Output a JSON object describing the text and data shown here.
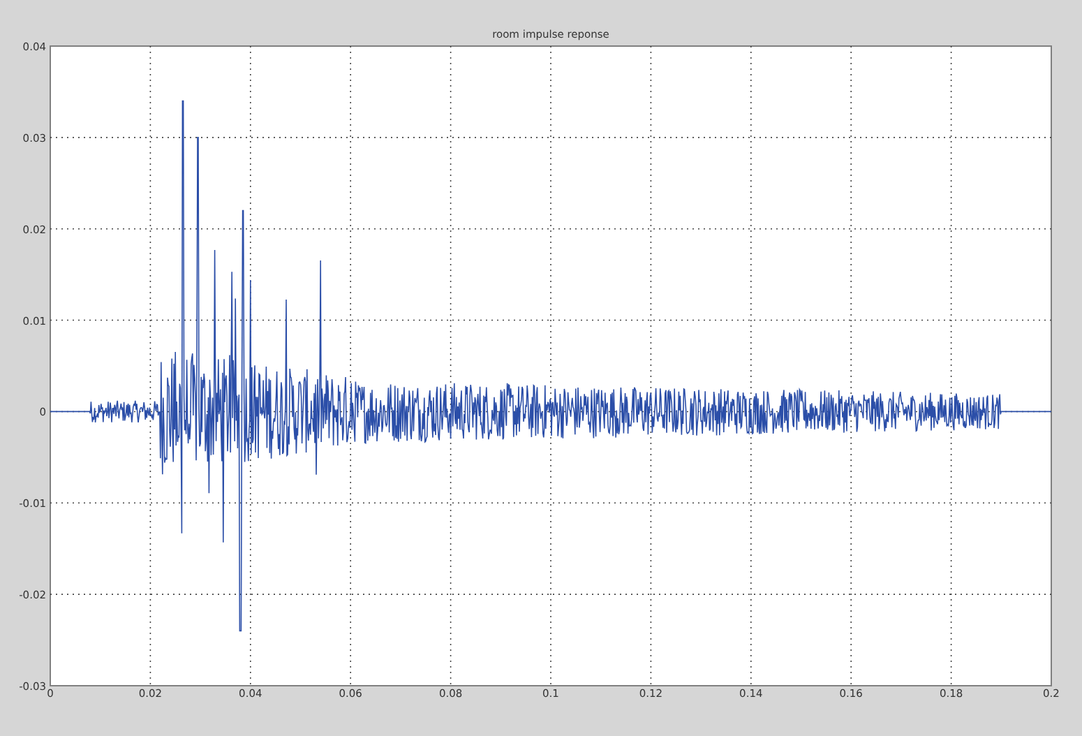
{
  "figure": {
    "title": "room impulse reponse",
    "yticks": [
      "0.04",
      "0.03",
      "0.02",
      "0.01",
      "0",
      "-0.01",
      "-0.02",
      "-0.03"
    ],
    "xticks": [
      "0",
      "0.02",
      "0.04",
      "0.06",
      "0.08",
      "0.1",
      "0.12",
      "0.14",
      "0.16",
      "0.18",
      "0.2"
    ]
  }
}
